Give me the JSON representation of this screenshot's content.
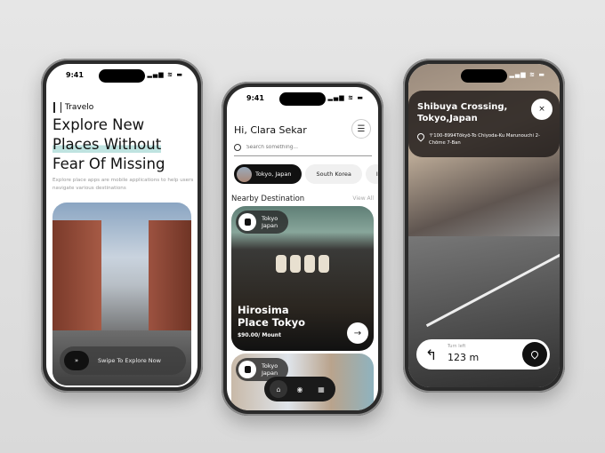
{
  "status_time": "9:41",
  "status_icons": "▂▄▆ ≋ ▬",
  "onboarding": {
    "brand": "Travelo",
    "headline_1": "Explore New",
    "headline_2": "Places Without",
    "headline_3": "Fear Of Missing",
    "subtitle": "Explore place apps are mobile applications to help users navigate various destinations",
    "swipe_icon": "»",
    "swipe_label": "Swipe To Explore Now"
  },
  "home": {
    "greeting": "Hi, Clara Sekar",
    "menu_icon": "☰",
    "search_placeholder": "Search something...",
    "chips": [
      "Tokyo, Japan",
      "South Korea",
      "Ind"
    ],
    "section_title": "Nearby Destination",
    "view_all": "View All",
    "cards": [
      {
        "tag_1": "Tokyo",
        "tag_2": "Japan",
        "title_1": "Hirosima",
        "title_2": "Place Tokyo",
        "price": "$90.00/ Mount",
        "arrow": "→"
      },
      {
        "tag_1": "Tokyo",
        "tag_2": "Japan"
      }
    ],
    "nav": [
      "⌂",
      "◉",
      "▦"
    ]
  },
  "navigation": {
    "title_1": "Shibuya Crossing,",
    "title_2": "Tokyo,Japan",
    "close": "×",
    "address": "〒100-8994Tōkyō-To Chiyoda-Ku Marunouchi 2-Chōme 7-Ban",
    "turn_icon": "↰",
    "turn_label": "Turn left",
    "distance": "123 m"
  }
}
